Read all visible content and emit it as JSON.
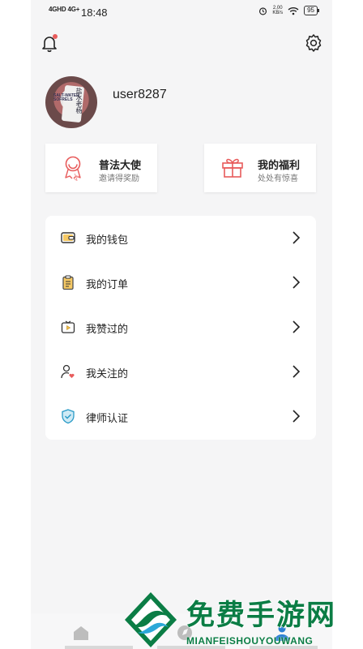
{
  "status_bar": {
    "signal1": "4GHD",
    "signal2": "4G+",
    "time": "18:48",
    "speed_value": "2.00",
    "speed_unit": "KB/s",
    "battery": "95"
  },
  "profile": {
    "username": "user8287"
  },
  "avatar_labels": {
    "bottle_text": "SALT-WATER SOFRELS",
    "bottle_cjk": "盐水老杨"
  },
  "cards": [
    {
      "title": "普法大使",
      "subtitle": "邀请得奖励",
      "icon": "badge-icon"
    },
    {
      "title": "我的福利",
      "subtitle": "处处有惊喜",
      "icon": "gift-icon"
    }
  ],
  "menu": [
    {
      "label": "我的钱包",
      "icon": "wallet-icon"
    },
    {
      "label": "我的订单",
      "icon": "clipboard-icon"
    },
    {
      "label": "我赞过的",
      "icon": "video-like-icon"
    },
    {
      "label": "我关注的",
      "icon": "user-heart-icon"
    },
    {
      "label": "律师认证",
      "icon": "shield-check-icon"
    }
  ],
  "watermark": {
    "cn": "免费手游网",
    "en": "MIANFEISHOUYOUWANG"
  },
  "colors": {
    "accent_red": "#e85c5c",
    "watermark_green": "#0b7d45",
    "background": "#f5f5f6"
  }
}
